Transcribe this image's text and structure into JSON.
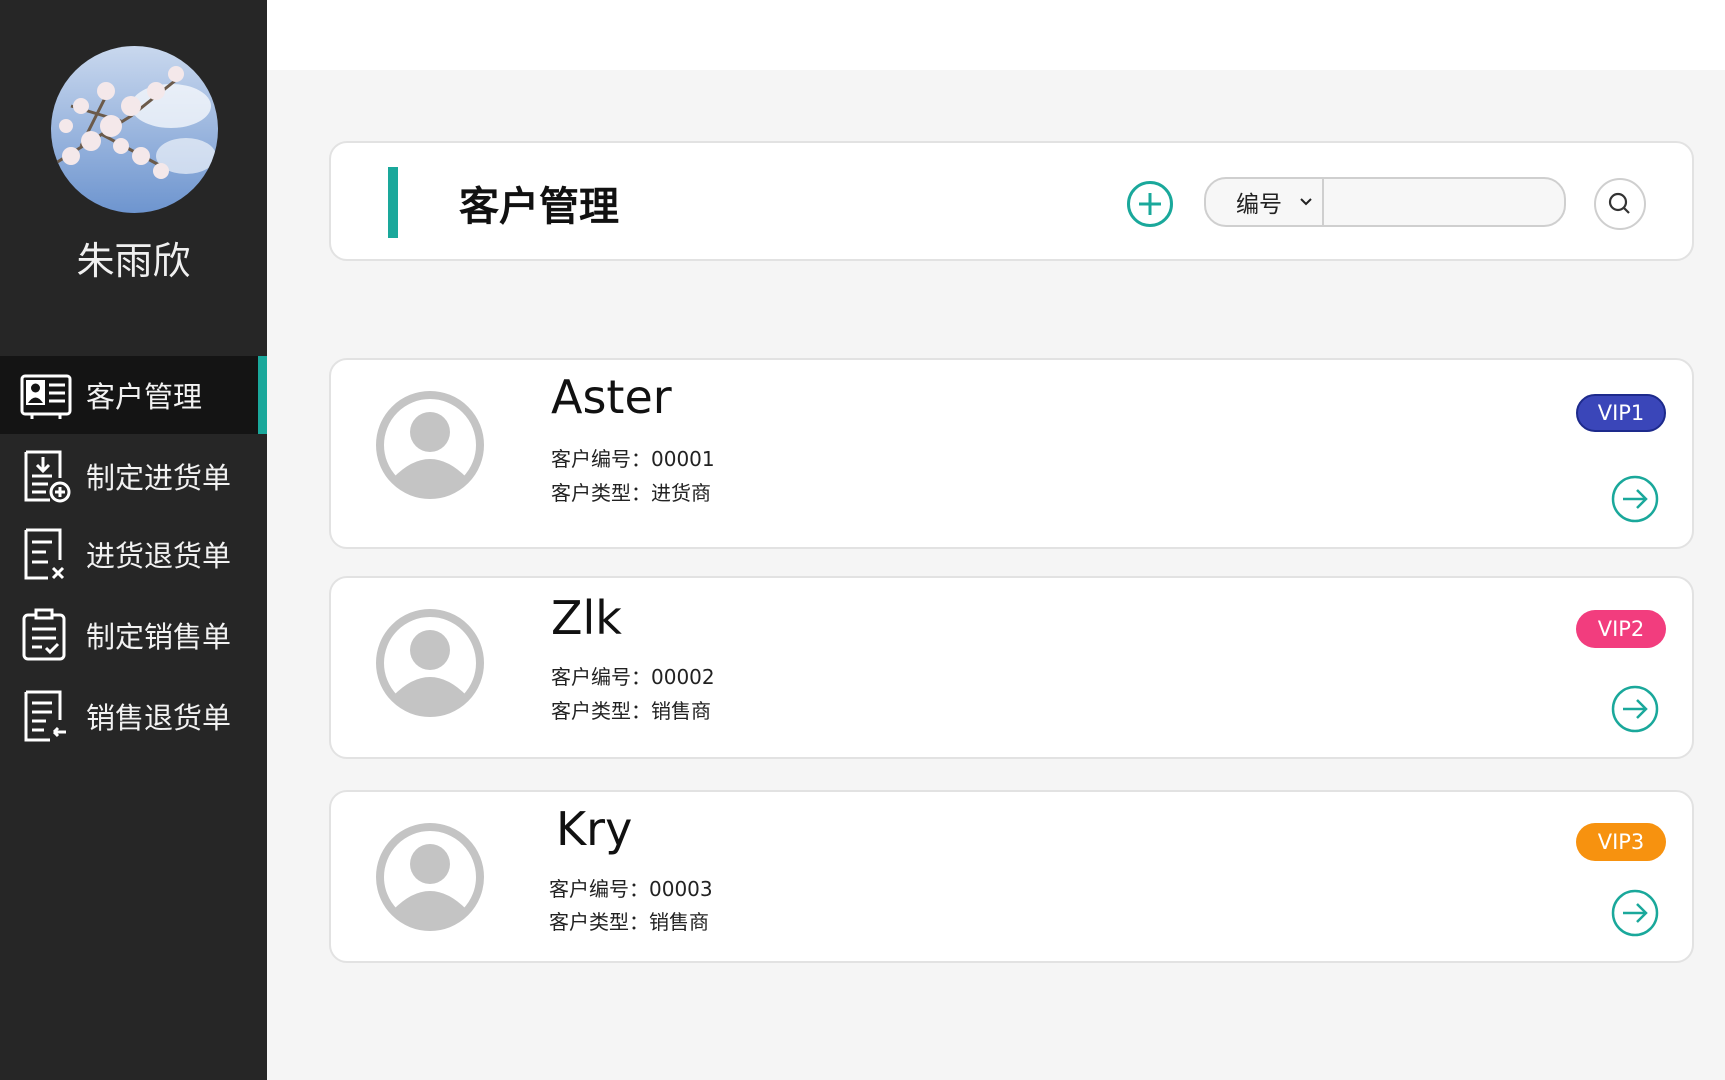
{
  "user": {
    "name": "朱雨欣"
  },
  "nav": {
    "items": [
      {
        "label": "客户管理",
        "icon": "customer-card-icon",
        "active": true
      },
      {
        "label": "制定进货单",
        "icon": "purchase-add-icon"
      },
      {
        "label": "进货退货单",
        "icon": "purchase-return-icon"
      },
      {
        "label": "制定销售单",
        "icon": "sales-checklist-icon"
      },
      {
        "label": "销售退货单",
        "icon": "sales-return-icon"
      }
    ]
  },
  "header": {
    "title": "客户管理",
    "search": {
      "field_label": "编号",
      "value": "",
      "placeholder": ""
    }
  },
  "customers": [
    {
      "name": "Aster",
      "id_label": "客户编号：00001",
      "type_label": "客户类型：进货商",
      "vip": "VIP1",
      "vip_color": "#3a46b9"
    },
    {
      "name": "Zlk",
      "id_label": "客户编号：00002",
      "type_label": "客户类型：销售商",
      "vip": "VIP2",
      "vip_color": "#f23d7e"
    },
    {
      "name": "Kry",
      "id_label": "客户编号：00003",
      "type_label": "客户类型：销售商",
      "vip": "VIP3",
      "vip_color": "#f7920f"
    }
  ],
  "colors": {
    "accent": "#1aa89b",
    "sidebar": "#262626"
  }
}
